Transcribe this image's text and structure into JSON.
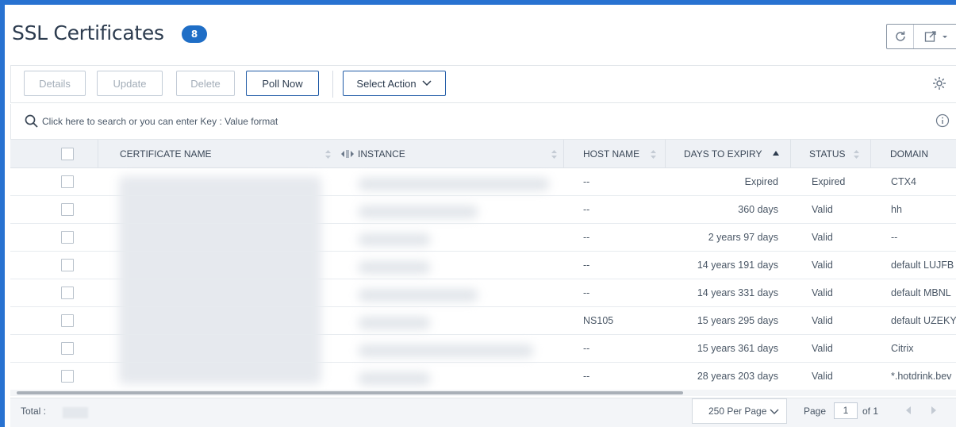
{
  "header": {
    "title": "SSL Certificates",
    "count": "8",
    "refresh_icon": "refresh-icon",
    "export_icon": "export-icon"
  },
  "toolbar": {
    "details_label": "Details",
    "update_label": "Update",
    "delete_label": "Delete",
    "poll_now_label": "Poll Now",
    "select_action_label": "Select Action",
    "settings_icon": "gear-icon"
  },
  "search": {
    "placeholder": "Click here to search or you can enter Key : Value format"
  },
  "table": {
    "columns": [
      "CERTIFICATE NAME",
      "INSTANCE",
      "HOST NAME",
      "DAYS TO EXPIRY",
      "STATUS",
      "DOMAIN"
    ],
    "sorted_column": "DAYS TO EXPIRY",
    "rows": [
      {
        "host_name": "--",
        "days_to_expiry": "Expired",
        "status": "Expired",
        "domain": "CTX4"
      },
      {
        "host_name": "--",
        "days_to_expiry": "360 days",
        "status": "Valid",
        "domain": "hh"
      },
      {
        "host_name": "--",
        "days_to_expiry": "2 years 97 days",
        "status": "Valid",
        "domain": "--"
      },
      {
        "host_name": "--",
        "days_to_expiry": "14 years 191 days",
        "status": "Valid",
        "domain": "default LUJFB"
      },
      {
        "host_name": "--",
        "days_to_expiry": "14 years 331 days",
        "status": "Valid",
        "domain": "default MBNL"
      },
      {
        "host_name": "NS105",
        "days_to_expiry": "15 years 295 days",
        "status": "Valid",
        "domain": "default UZEKY"
      },
      {
        "host_name": "--",
        "days_to_expiry": "15 years 361 days",
        "status": "Valid",
        "domain": "Citrix"
      },
      {
        "host_name": "--",
        "days_to_expiry": "28 years 203 days",
        "status": "Valid",
        "domain": "*.hotdrink.bev"
      }
    ]
  },
  "footer": {
    "total_label": "Total :",
    "per_page": "250 Per Page",
    "page_label": "Page",
    "page_value": "1",
    "of_label": "of 1"
  },
  "colors": {
    "accent": "#2872d1",
    "badge": "#1f6ec6"
  }
}
